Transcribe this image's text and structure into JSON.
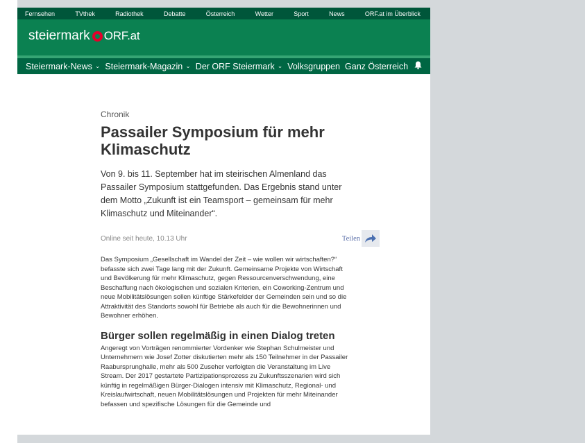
{
  "topnav": {
    "items": [
      "Fernsehen",
      "TVthek",
      "Radiothek",
      "Debatte",
      "Österreich",
      "Wetter",
      "Sport",
      "News",
      "ORF.at im Überblick"
    ]
  },
  "brand": {
    "region": "steiermark",
    "orf": "ORF.at"
  },
  "mainnav": {
    "items": [
      "Steiermark-News",
      "Steiermark-Magazin",
      "Der ORF Steiermark",
      "Volksgruppen",
      "Ganz Österreich"
    ],
    "chevron_glyph": "⌄"
  },
  "article": {
    "category": "Chronik",
    "title": "Passailer Symposium für mehr Klimaschutz",
    "lead": "Von 9. bis 11. September hat im steirischen Almenland das Passailer Symposium stattgefunden. Das Ergebnis stand unter dem Motto „Zukunft ist ein Teamsport – gemeinsam für mehr Klimaschutz und Miteinander“.",
    "date": "Online seit heute, 10.13 Uhr",
    "share_label": "Teilen",
    "paragraph1": "Das Symposium „Gesellschaft im Wandel der Zeit – wie wollen wir wirtschaften?“ befasste sich zwei Tage lang mit der Zukunft. Gemeinsame Projekte von Wirtschaft und Bevölkerung für mehr Klimaschutz, gegen Ressourcenverschwendung, eine Beschaffung nach ökologischen und sozialen Kriterien, ein Coworking-Zentrum und neue Mobilitätslösungen sollen künftige Stärkefelder der Gemeinden sein und so die Attraktivität des Standorts sowohl für Betriebe als auch für die Bewohnerinnen und Bewohner erhöhen.",
    "subheading": "Bürger sollen regelmäßig in einen Dialog treten",
    "paragraph2": "Angeregt von Vorträgen renommierter Vordenker wie Stephan Schulmeister und Unternehmern wie Josef Zotter diskutierten mehr als 150 Teilnehmer in der Passailer Raabursprunghalle, mehr als 500 Zuseher verfolgten die Veranstaltung im Live Stream. Der 2017 gestartete Partizipationsprozess zu Zukunftsszenarien wird sich künftig in regelmäßigen Bürger-Dialogen intensiv mit Klimaschutz, Regional- und Kreislaufwirtschaft, neuen Mobilitätslösungen und Projekten für mehr Miteinander befassen und spezifische Lösungen für die Gemeinde und"
  },
  "colors": {
    "topbar": "#00563a",
    "brandbar": "#0b8151",
    "stripe": "#36a574",
    "navbar": "#006643",
    "logo_red": "#e4002b",
    "share_link": "#5b6fa8",
    "page_bg": "#d4d8db"
  },
  "icons": {
    "notification": "bell-icon",
    "share": "share-arrow-icon",
    "logo": "orf-logo-icon"
  }
}
